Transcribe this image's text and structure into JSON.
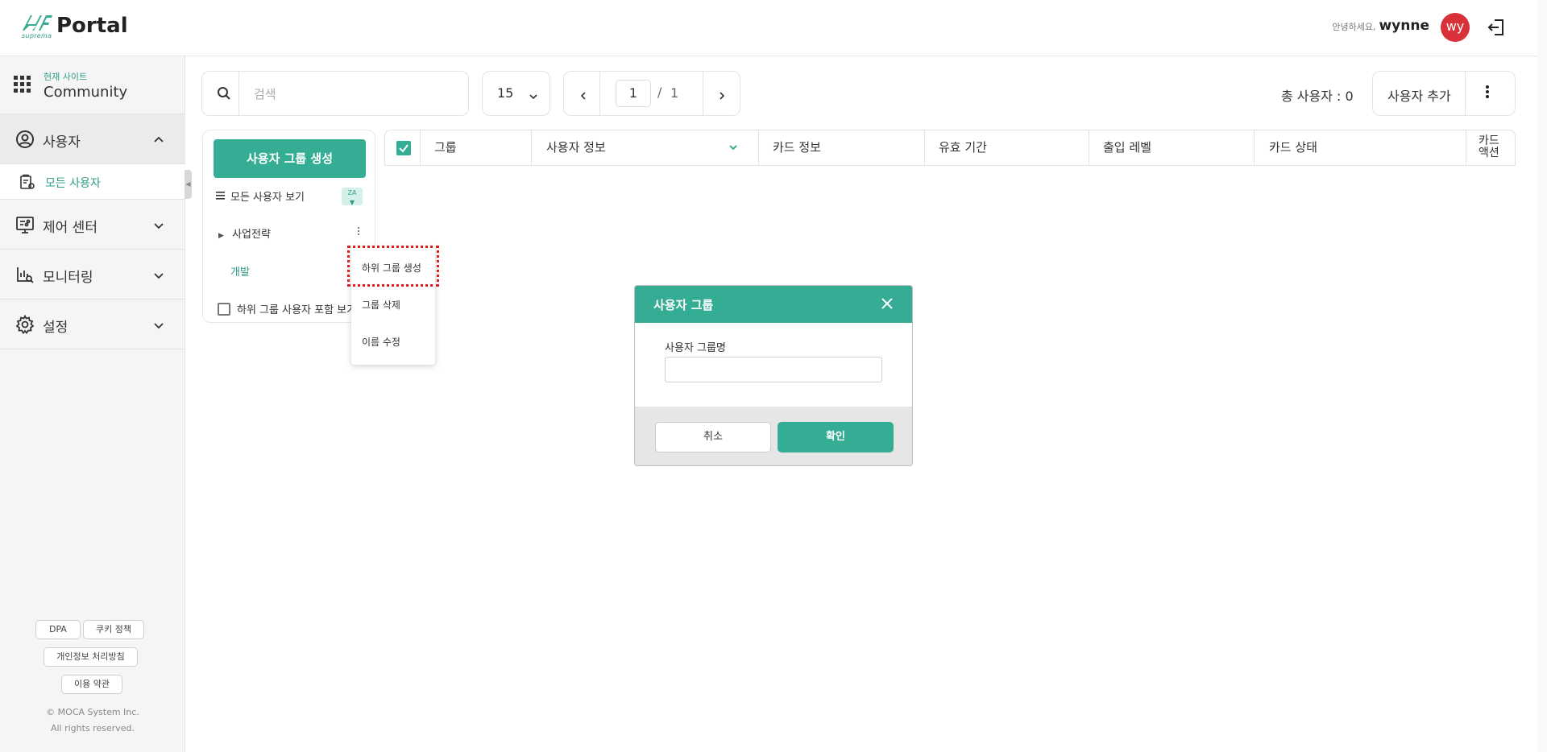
{
  "header": {
    "logo_sub": "suprema",
    "logo_text": "Portal",
    "greeting": "안녕하세요,",
    "username": "wynne",
    "avatar_initials": "wy"
  },
  "sidebar": {
    "site_label": "현재 사이트",
    "site_name": "Community",
    "items": [
      {
        "label": "사용자",
        "icon": "user-icon",
        "expanded": true
      },
      {
        "label": "제어 센터",
        "icon": "control-center-icon",
        "expanded": false
      },
      {
        "label": "모니터링",
        "icon": "monitoring-icon",
        "expanded": false
      },
      {
        "label": "설정",
        "icon": "gear-icon",
        "expanded": false
      }
    ],
    "sub_item": "모든 사용자",
    "footer": {
      "dpa": "DPA",
      "cookie": "쿠키 정책",
      "privacy": "개인정보 처리방침",
      "terms": "이용 약관",
      "copyright_1": "© MOCA System Inc.",
      "copyright_2": "All rights reserved."
    }
  },
  "toolbar": {
    "search_placeholder": "검색",
    "page_size": "15",
    "current_page": "1",
    "slash": "/",
    "total_pages": "1",
    "total_users": "총 사용자 : 0",
    "add_user": "사용자 추가"
  },
  "groups": {
    "create_button": "사용자 그룹 생성",
    "view_all": "모든 사용자 보기",
    "sort_badge": "ZA",
    "tree": [
      {
        "label": "사업전략",
        "collapsed": true
      },
      {
        "label": "개발",
        "selected": true
      }
    ],
    "include_sub": "하위 그룹 사용자 포함 보기"
  },
  "context_menu": {
    "items": [
      "하위 그룹 생성",
      "그룹 삭제",
      "이름 수정"
    ]
  },
  "table": {
    "columns": [
      "그룹",
      "사용자 정보",
      "카드 정보",
      "유효 기간",
      "출입 레벨",
      "카드 상태",
      "카드\n액션"
    ]
  },
  "dialog": {
    "title": "사용자 그룹",
    "field_label": "사용자 그룹명",
    "field_value": "",
    "cancel": "취소",
    "confirm": "확인"
  },
  "colors": {
    "accent": "#34ad94",
    "avatar": "#d9313a",
    "highlight": "#e01b1b"
  }
}
